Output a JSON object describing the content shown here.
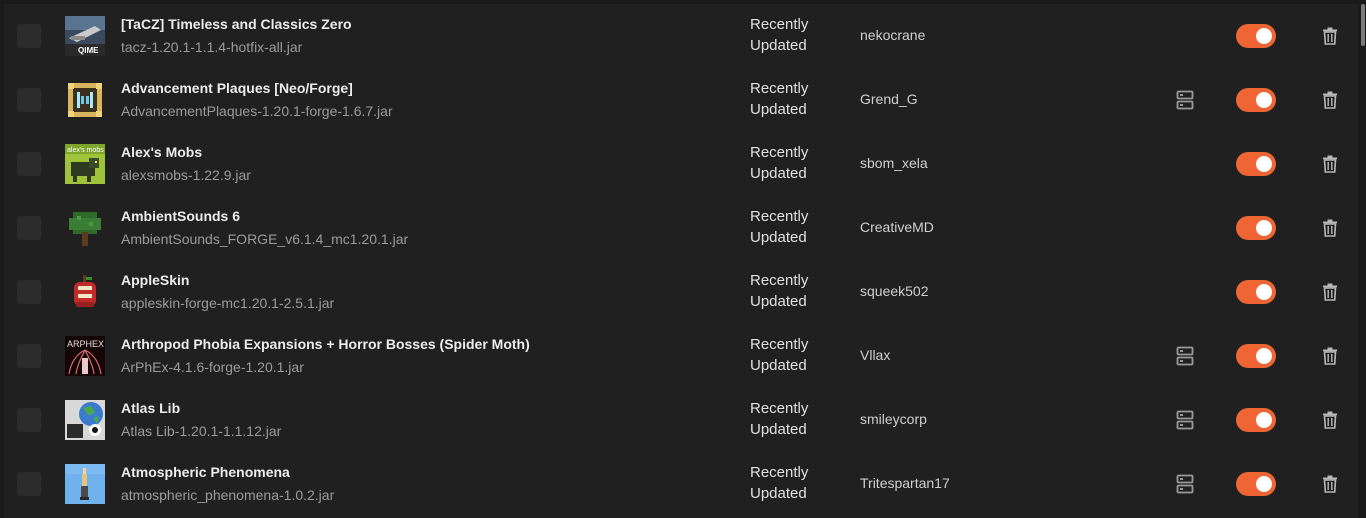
{
  "accent_color": "#ef6534",
  "mods": [
    {
      "name": "[TaCZ] Timeless and Classics Zero",
      "file": "tacz-1.20.1-1.1.4-hotfix-all.jar",
      "status": "Recently Updated",
      "author": "nekocrane",
      "server_side": false,
      "enabled": true,
      "icon": "tacz-mod-icon"
    },
    {
      "name": "Advancement Plaques [Neo/Forge]",
      "file": "AdvancementPlaques-1.20.1-forge-1.6.7.jar",
      "status": "Recently Updated",
      "author": "Grend_G",
      "server_side": true,
      "enabled": true,
      "icon": "advancement-plaques-mod-icon"
    },
    {
      "name": "Alex's Mobs",
      "file": "alexsmobs-1.22.9.jar",
      "status": "Recently Updated",
      "author": "sbom_xela",
      "server_side": false,
      "enabled": true,
      "icon": "alexs-mobs-mod-icon"
    },
    {
      "name": "AmbientSounds 6",
      "file": "AmbientSounds_FORGE_v6.1.4_mc1.20.1.jar",
      "status": "Recently Updated",
      "author": "CreativeMD",
      "server_side": false,
      "enabled": true,
      "icon": "ambientsounds-mod-icon"
    },
    {
      "name": "AppleSkin",
      "file": "appleskin-forge-mc1.20.1-2.5.1.jar",
      "status": "Recently Updated",
      "author": "squeek502",
      "server_side": false,
      "enabled": true,
      "icon": "appleskin-mod-icon"
    },
    {
      "name": "Arthropod Phobia Expansions + Horror Bosses (Spider Moth)",
      "file": "ArPhEx-4.1.6-forge-1.20.1.jar",
      "status": "Recently Updated",
      "author": "Vllax",
      "server_side": true,
      "enabled": true,
      "icon": "arphex-mod-icon"
    },
    {
      "name": "Atlas Lib",
      "file": "Atlas Lib-1.20.1-1.1.12.jar",
      "status": "Recently Updated",
      "author": "smileycorp",
      "server_side": true,
      "enabled": true,
      "icon": "atlas-lib-mod-icon"
    },
    {
      "name": "Atmospheric Phenomena",
      "file": "atmospheric_phenomena-1.0.2.jar",
      "status": "Recently Updated",
      "author": "Tritespartan17",
      "server_side": true,
      "enabled": true,
      "icon": "atmospheric-phenomena-mod-icon"
    }
  ],
  "icon_labels": {
    "tacz": "QIME",
    "alexs_mobs": "alex's mobs",
    "arphex": "ARPHEX"
  }
}
